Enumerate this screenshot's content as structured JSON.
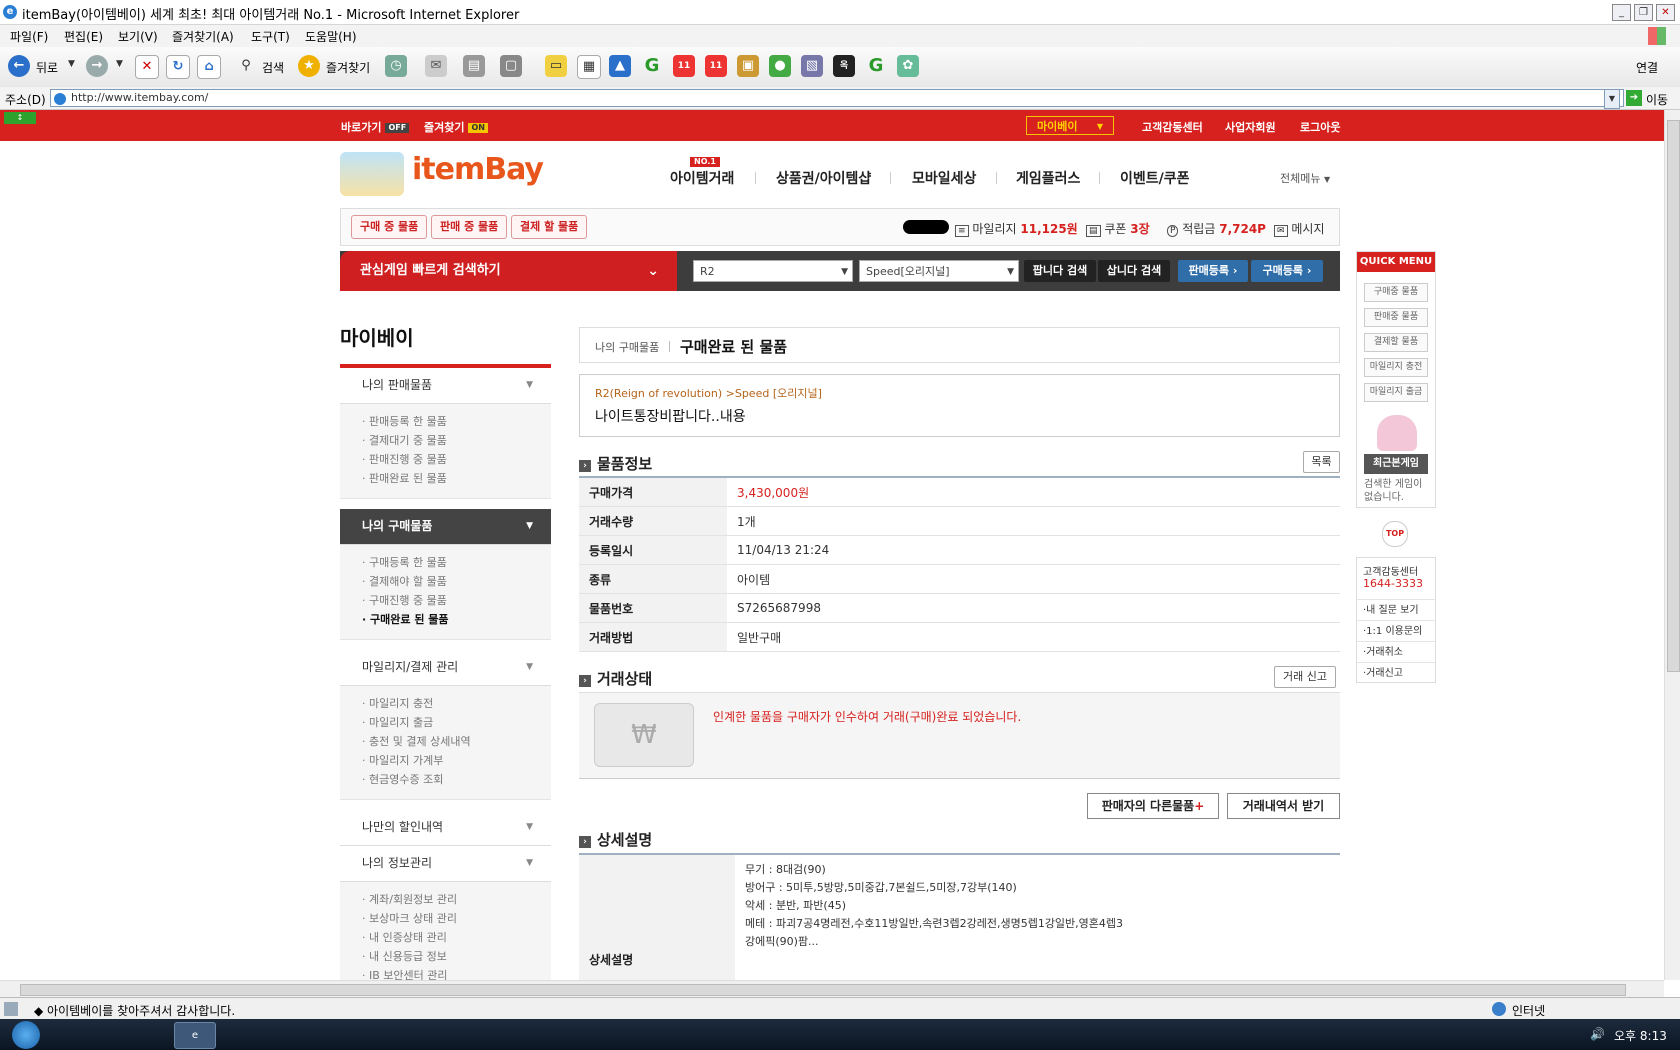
{
  "window": {
    "title": "itemBay(아이템베이) 세계 최초! 최대 아이템거래 No.1 - Microsoft Internet Explorer",
    "menu": [
      "파일(F)",
      "편집(E)",
      "보기(V)",
      "즐겨찾기(A)",
      "도구(T)",
      "도움말(H)"
    ],
    "toolbar": {
      "back": "뒤로",
      "search": "검색",
      "favorites": "즐겨찾기",
      "connect": "연결"
    },
    "address_label": "주소(D)",
    "address": "http://www.itembay.com/",
    "go": "이동",
    "status_text": "◆ 아이템베이를 찾아주셔서 감사합니다.",
    "status_zone": "인터넷",
    "clock": "오후 8:13"
  },
  "topnav": {
    "shortcut": "바로가기",
    "shortcut_tag": "OFF",
    "favorites": "즐겨찾기",
    "favorites_tag": "ON",
    "mybay": "마이베이",
    "cs": "고객감동센터",
    "business": "사업자회원",
    "logout": "로그아웃"
  },
  "logo": {
    "text": "itemBay"
  },
  "gnb": {
    "badge": "NO.1",
    "items": [
      "아이템거래",
      "상품권/아이템샵",
      "모바일세상",
      "게임플러스",
      "이벤트/쿠폰"
    ],
    "all_menu": "전체메뉴"
  },
  "tradebar": {
    "buttons": [
      "구매 중 물품",
      "판매 중 물품",
      "결제 할 물품"
    ],
    "mileage_label": "마일리지",
    "mileage_value": "11,125원",
    "coupon_label": "쿠폰",
    "coupon_value": "3장",
    "points_label": "적립금",
    "points_value": "7,724P",
    "message_label": "메시지"
  },
  "search": {
    "label": "관심게임 빠르게 검색하기",
    "game": "R2",
    "server": "Speed[오리지널]",
    "sell_search": "팝니다 검색",
    "buy_search": "삽니다 검색",
    "sell_register": "판매등록",
    "buy_register": "구매등록"
  },
  "leftmenu": {
    "title": "마이베이",
    "sections": [
      {
        "label": "나의 판매물품",
        "items": [
          "· 판매등록 한 물품",
          "· 결제대기 중 물품",
          "· 판매진행 중 물품",
          "· 판매완료 된 물품"
        ]
      },
      {
        "label": "나의 구매물품",
        "items": [
          "· 구매등록 한 물품",
          "· 결제해야 할 물품",
          "· 구매진행 중 물품",
          "· 구매완료 된 물품"
        ]
      },
      {
        "label": "마일리지/결제 관리",
        "items": [
          "· 마일리지 충전",
          "· 마일리지 출금",
          "· 충전 및 결제 상세내역",
          "· 마일리지 가계부",
          "· 현금영수증 조회"
        ]
      },
      {
        "label": "나만의 할인내역",
        "items": []
      },
      {
        "label": "나의 정보관리",
        "items": [
          "· 계좌/회원정보 관리",
          "· 보상마크 상태 관리",
          "· 내 인증상태 관리",
          "· 내 신용등급 정보",
          "· IB 보안센터 관리"
        ]
      }
    ]
  },
  "content": {
    "crumb_parent": "나의 구매물품",
    "crumb_current": "구매완료 된 물품",
    "item_path": "R2(Reign of revolution) >Speed [오리지널]",
    "item_title": "나이트통장비팝니다..내용",
    "info_title": "물품정보",
    "list_btn": "목록",
    "info_rows": [
      {
        "label": "구매가격",
        "value": "3,430,000원"
      },
      {
        "label": "거래수량",
        "value": "1개"
      },
      {
        "label": "등록일시",
        "value": "11/04/13 21:24"
      },
      {
        "label": "종류",
        "value": "아이템"
      },
      {
        "label": "물품번호",
        "value": "S7265687998"
      },
      {
        "label": "거래방법",
        "value": "일반구매"
      }
    ],
    "status_title": "거래상태",
    "report_btn": "거래 신고",
    "status_message": "인계한 물품을 구매자가 인수하여 거래(구매)완료 되었습니다.",
    "seller_items_btn": "판매자의 다른물품",
    "history_btn": "거래내역서 받기",
    "detail_title": "상세설명",
    "detail_label": "상세설명",
    "detail_lines": [
      "무기 : 8대검(90)",
      "방어구 : 5미투,5방망,5미중갑,7본쉴드,5미장,7강부(140)",
      "악세 : 분반, 파반(45)",
      "메테 : 파괴7공4명레전,수호11방일반,속련3렙2강레전,생명5렙1강일반,영혼4렙3",
      "강에픽(90)팜..."
    ]
  },
  "quick": {
    "head": "QUICK MENU",
    "buttons": [
      "구매중 물품",
      "판매중 물품",
      "결제할 물품",
      "마일리지 충전",
      "마일리지 출금"
    ],
    "recent": "최근본게임",
    "recent_empty": "검색한 게임이 없습니다.",
    "top": "TOP",
    "cs_title": "고객감동센터",
    "cs_phone": "1644-3333",
    "cs_links": [
      "·내 질문 보기",
      "·1:1 이용문의",
      "·거래취소",
      "·거래신고"
    ]
  }
}
